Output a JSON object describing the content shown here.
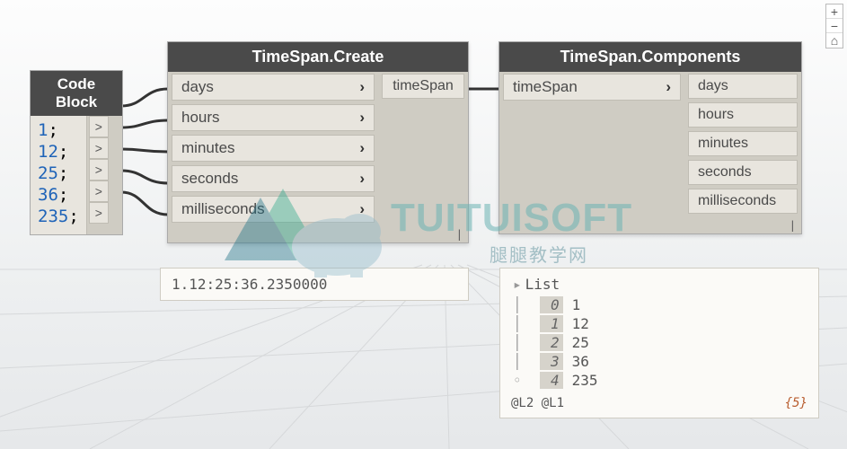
{
  "zoom": {
    "in": "+",
    "out": "−",
    "fit": "⌂"
  },
  "codeBlock": {
    "title": "Code Block",
    "lines": [
      "1",
      "12",
      "25",
      "36",
      "235"
    ],
    "semicolon": ";",
    "outChevron": ">"
  },
  "create": {
    "title": "TimeSpan.Create",
    "inputs": [
      "days",
      "hours",
      "minutes",
      "seconds",
      "milliseconds"
    ],
    "output": "timeSpan",
    "chevron": "›",
    "lacing": "|",
    "preview": "1.12:25:36.2350000"
  },
  "components": {
    "title": "TimeSpan.Components",
    "input": "timeSpan",
    "outputs": [
      "days",
      "hours",
      "minutes",
      "seconds",
      "milliseconds"
    ],
    "chevron": "›",
    "lacing": "|",
    "preview": {
      "title": "List",
      "items": [
        {
          "idx": "0",
          "val": "1"
        },
        {
          "idx": "1",
          "val": "12"
        },
        {
          "idx": "2",
          "val": "25"
        },
        {
          "idx": "3",
          "val": "36"
        },
        {
          "idx": "4",
          "val": "235"
        }
      ],
      "footer": "@L2 @L1",
      "count": "{5}"
    }
  },
  "watermark": {
    "text": "TUITUISOFT",
    "sub": "腿腿教学网"
  }
}
